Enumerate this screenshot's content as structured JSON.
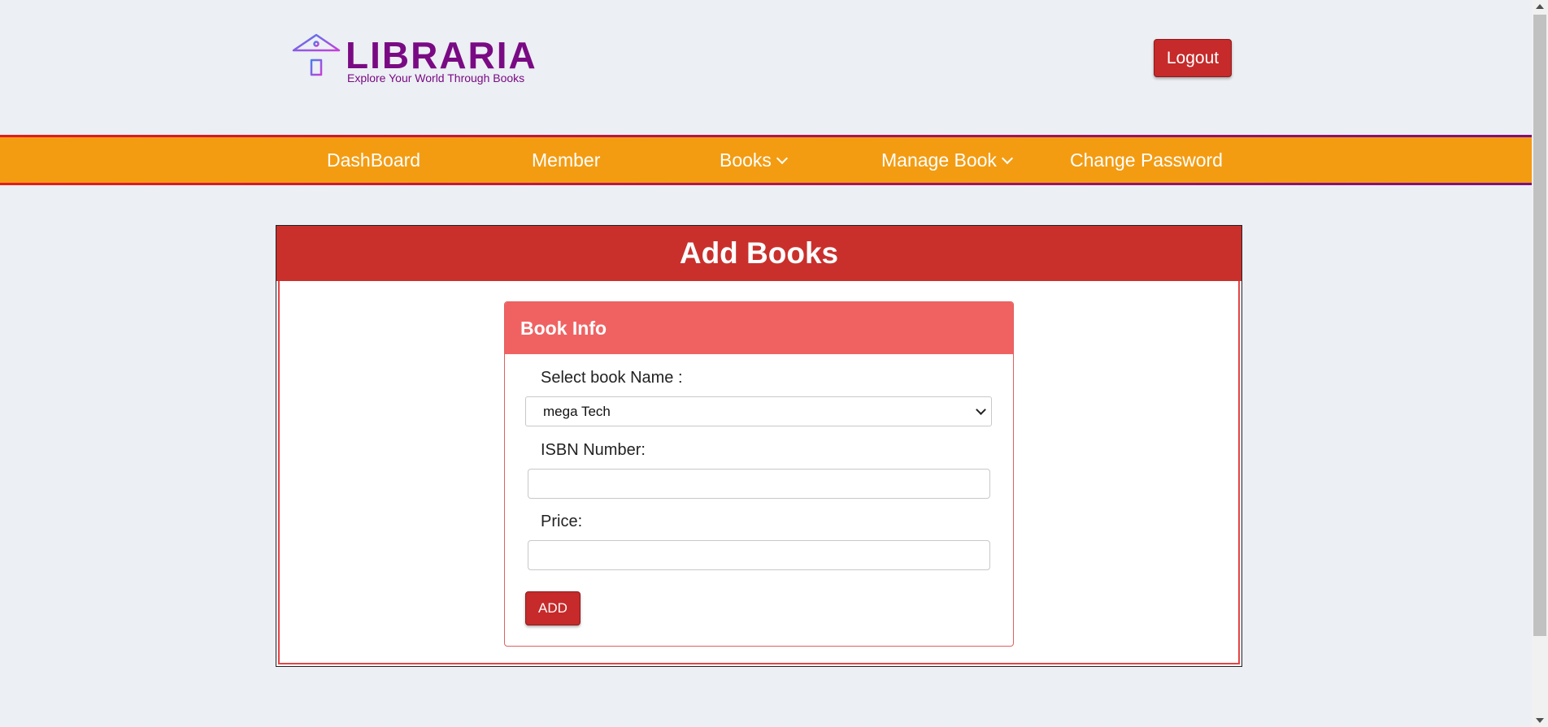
{
  "brand": {
    "name": "LIBRARIA",
    "tagline": "Explore Your World Through Books"
  },
  "header": {
    "logout_label": "Logout"
  },
  "nav": {
    "items": [
      {
        "label": "DashBoard"
      },
      {
        "label": "Member"
      },
      {
        "label": "Books"
      },
      {
        "label": "Manage Book"
      },
      {
        "label": "Change Password"
      }
    ]
  },
  "panel": {
    "title": "Add Books"
  },
  "card": {
    "title": "Book Info",
    "select_label": "Select book Name :",
    "select_value": "mega Tech",
    "isbn_label": "ISBN Number:",
    "isbn_value": "",
    "price_label": "Price:",
    "price_value": "",
    "add_label": "ADD"
  },
  "colors": {
    "brand_purple": "#7a0a84",
    "nav_orange": "#f39c12",
    "button_red": "#c62a2a",
    "panel_red": "#c9302c",
    "card_head": "#f06262"
  }
}
